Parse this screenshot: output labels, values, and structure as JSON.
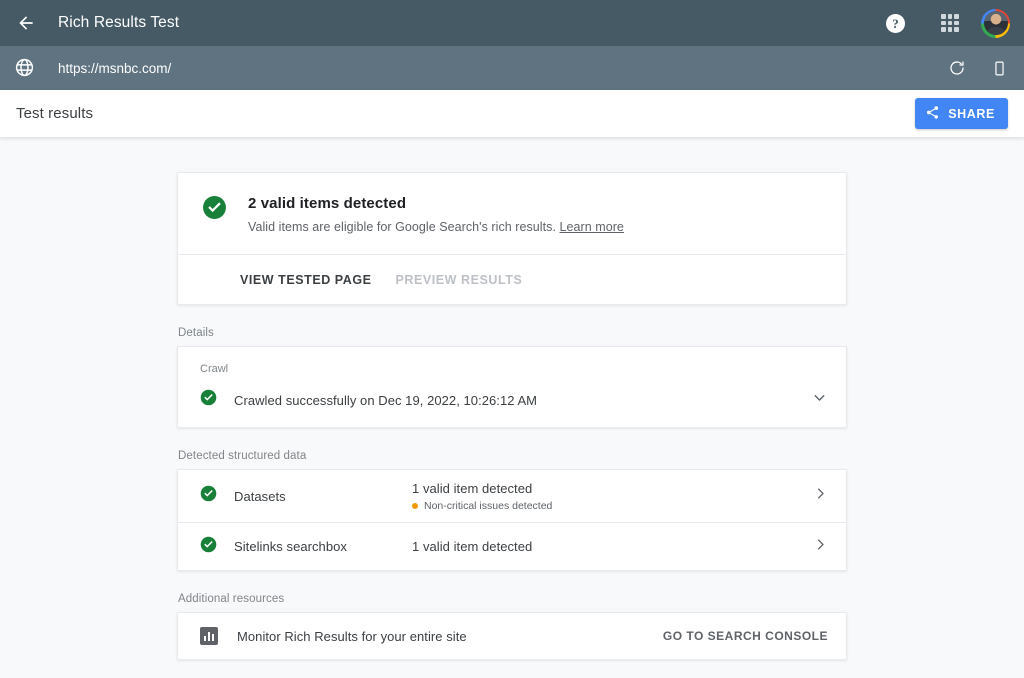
{
  "appbar": {
    "back_icon": "back-arrow-icon",
    "title": "Rich Results Test",
    "help_icon": "?",
    "apps_icon": "apps-grid-icon",
    "avatar_icon": "user-avatar"
  },
  "urlbar": {
    "globe_icon": "globe-icon",
    "url": "https://msnbc.com/",
    "refresh_icon": "refresh-icon",
    "mobile_icon": "mobile-device-icon"
  },
  "results_header": {
    "title": "Test results",
    "share_label": "SHARE",
    "share_icon": "share-icon",
    "share_color": "#4285f4"
  },
  "summary": {
    "status_icon": "check-circle-icon",
    "status_color": "#188038",
    "title": "2 valid items detected",
    "subtitle": "Valid items are eligible for Google Search's rich results.",
    "learn_more": "Learn more",
    "view_tested_page": "VIEW TESTED PAGE",
    "preview_results": "PREVIEW RESULTS"
  },
  "details": {
    "section_label": "Details",
    "crawl_label": "Crawl",
    "crawl_status_icon": "check-circle-icon",
    "crawl_status": "Crawled successfully on Dec 19, 2022, 10:26:12 AM",
    "expand_icon": "chevron-down-icon"
  },
  "structured_data": {
    "section_label": "Detected structured data",
    "rows": [
      {
        "status_icon": "check-circle-icon",
        "name": "Datasets",
        "status": "1 valid item detected",
        "issue": "Non-critical issues detected",
        "issue_color": "#f29900",
        "chevron": "chevron-right-icon"
      },
      {
        "status_icon": "check-circle-icon",
        "name": "Sitelinks searchbox",
        "status": "1 valid item detected",
        "issue": "",
        "chevron": "chevron-right-icon"
      }
    ]
  },
  "additional_resources": {
    "section_label": "Additional resources",
    "icon": "bar-chart-icon",
    "text": "Monitor Rich Results for your entire site",
    "action_label": "GO TO SEARCH CONSOLE"
  }
}
